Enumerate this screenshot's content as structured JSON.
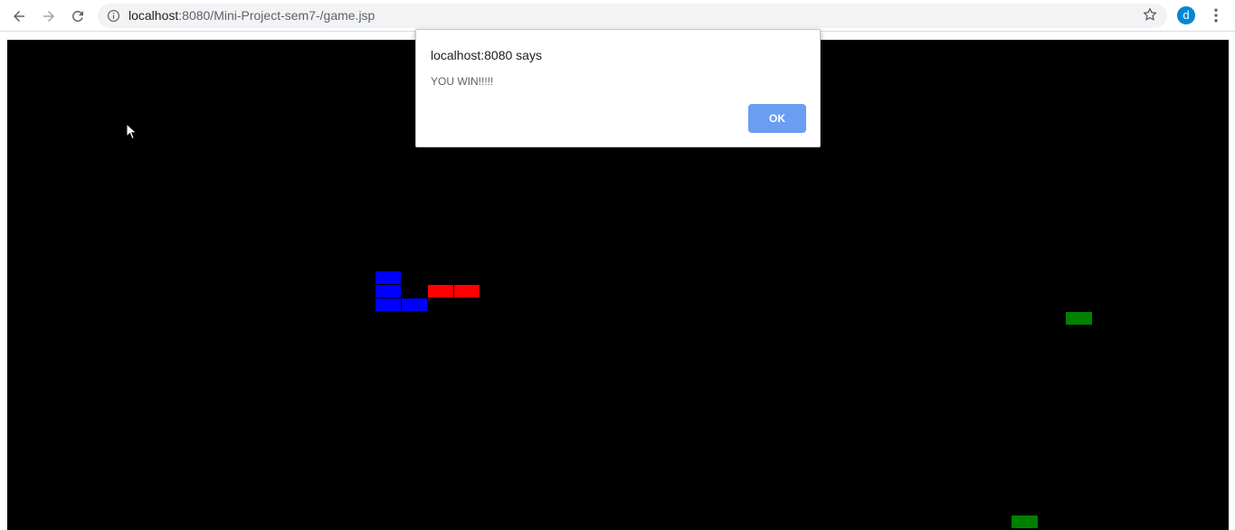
{
  "browser": {
    "url_host": "localhost",
    "url_rest": ":8080/Mini-Project-sem7-/game.jsp",
    "profile_initial": "d",
    "icons": {
      "back": "back-arrow-icon",
      "forward": "forward-arrow-icon",
      "reload": "reload-icon",
      "site_info": "info-icon",
      "bookmark": "star-icon",
      "menu": "kebab-menu-icon"
    }
  },
  "dialog": {
    "title": "localhost:8080 says",
    "message": "YOU WIN!!!!!",
    "ok_label": "OK",
    "accent": "#6b9ef2"
  },
  "game": {
    "background": "#000000",
    "colors": {
      "player_snake": "#0000ff",
      "enemy_snake": "#ff0000",
      "food": "#008000"
    },
    "blue_segments": 4,
    "red_segments": 2,
    "green_blocks": 2
  }
}
